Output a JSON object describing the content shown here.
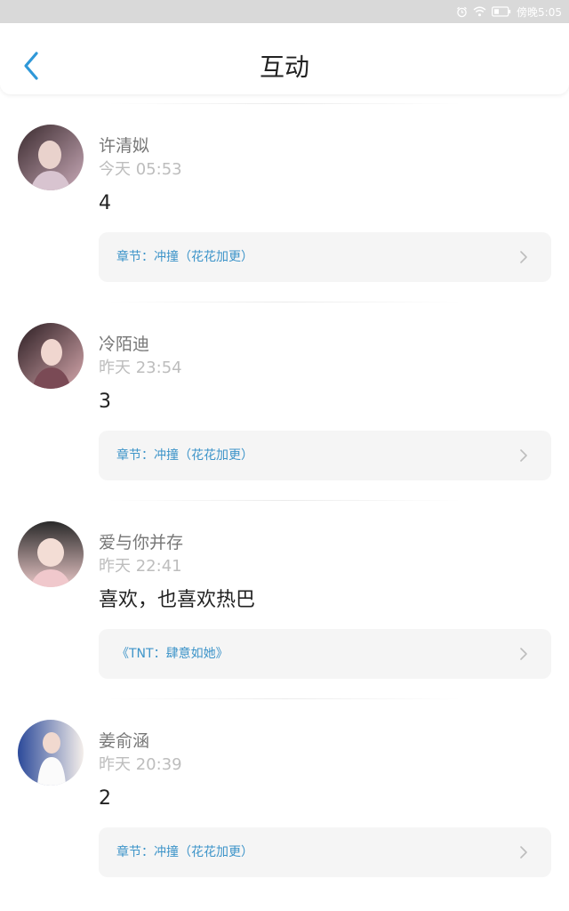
{
  "status_bar": {
    "time": "傍晚5:05"
  },
  "header": {
    "title": "互动"
  },
  "feed": [
    {
      "name": "许清姒",
      "time": "今天 05:53",
      "comment": "4",
      "link": "章节：冲撞（花花加更）",
      "avatar_colors": [
        "#3a2a2e",
        "#c9aab8"
      ]
    },
    {
      "name": "冷陌迪",
      "time": "昨天 23:54",
      "comment": "3",
      "link": "章节：冲撞（花花加更）",
      "avatar_colors": [
        "#2b1d22",
        "#d6a8ad"
      ]
    },
    {
      "name": "爱与你并存",
      "time": "昨天 22:41",
      "comment": "喜欢，也喜欢热巴",
      "link": "《TNT：肆意如她》",
      "avatar_colors": [
        "#2a2a2a",
        "#e8c6c6"
      ]
    },
    {
      "name": "姜俞涵",
      "time": "昨天 20:39",
      "comment": "2",
      "link": "章节：冲撞（花花加更）",
      "avatar_colors": [
        "#2c4a9a",
        "#f4eeea"
      ]
    }
  ],
  "colors": {
    "accent": "#2f98d8",
    "link": "#3d94c9",
    "chip_bg": "#f5f5f5"
  }
}
